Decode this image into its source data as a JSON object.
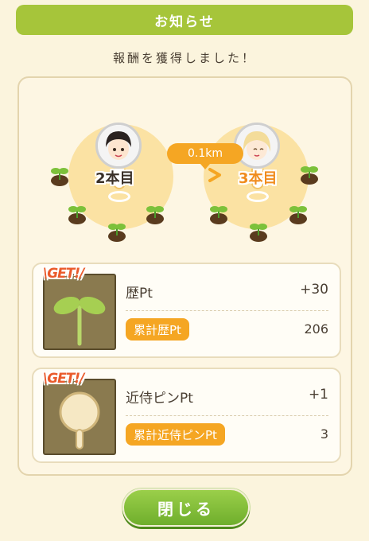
{
  "header": {
    "title": "お知らせ"
  },
  "subtitle": "報酬を獲得しました！",
  "route": {
    "from_label": "2本目",
    "to_label": "3本目",
    "distance": "0.1km"
  },
  "rewards": [
    {
      "badge": "\\GET!/",
      "title": "歴Pt",
      "value": "+30",
      "total_label": "累計歴Pt",
      "total_value": "206",
      "icon": "sprout-icon"
    },
    {
      "badge": "\\GET!/",
      "title": "近侍ピンPt",
      "value": "+1",
      "total_label": "累計近侍ピンPt",
      "total_value": "3",
      "icon": "pin-icon"
    }
  ],
  "footer": {
    "close_label": "閉じる"
  },
  "colors": {
    "header_green": "#a6c53a",
    "accent_orange": "#f5a623",
    "button_green": "#7cbb35",
    "background": "#fbf4dd"
  }
}
